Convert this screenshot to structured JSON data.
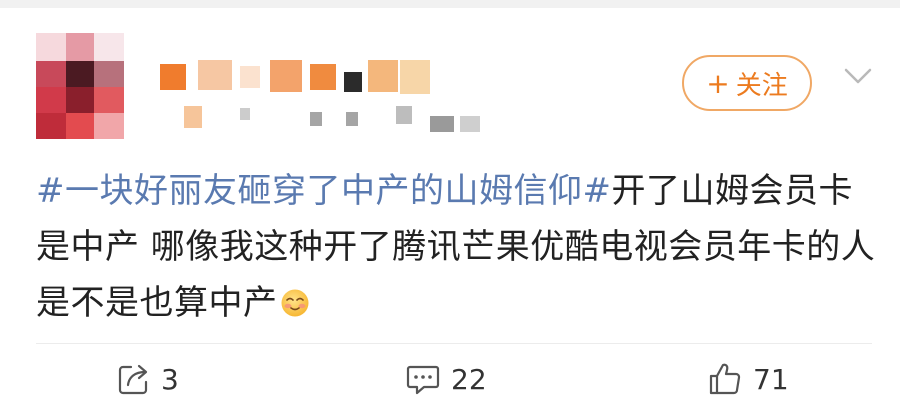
{
  "post": {
    "follow_label": "关注",
    "follow_plus": "+",
    "topic": "#一块好丽友砸穿了中产的山姆信仰#",
    "body_text": "开了山姆会员卡是中产 哪像我这种开了腾讯芒果优酷电视会员年卡的人是不是也算中产",
    "emoji": "blush-smile-emoji"
  },
  "actions": {
    "repost_count": "3",
    "comment_count": "22",
    "like_count": "71"
  },
  "icons": {
    "repost": "repost-icon",
    "comment": "comment-icon",
    "like": "thumbs-up-icon",
    "more": "chevron-down-icon"
  },
  "colors": {
    "topic": "#5a7ab0",
    "follow_accent": "#ec7b1f",
    "follow_border": "#f0a865",
    "text": "#222222"
  }
}
